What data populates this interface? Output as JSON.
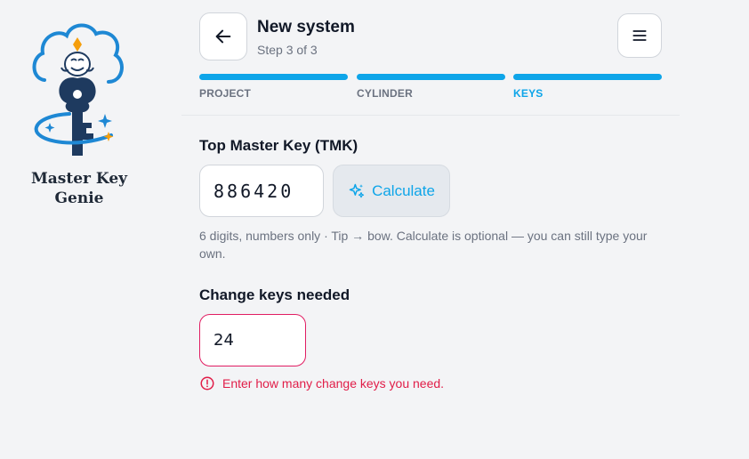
{
  "brand": {
    "name_line1": "Master Key",
    "name_line2": "Genie",
    "logo_icon": "genie-key-logo"
  },
  "header": {
    "title": "New system",
    "subtitle": "Step 3 of 3",
    "back_icon": "arrow-left-icon",
    "menu_icon": "hamburger-menu-icon"
  },
  "steps": [
    {
      "label": "PROJECT",
      "state": "complete"
    },
    {
      "label": "CYLINDER",
      "state": "complete"
    },
    {
      "label": "KEYS",
      "state": "active"
    }
  ],
  "tmk": {
    "label": "Top Master Key (TMK)",
    "value": "886420",
    "calculate_label": "Calculate",
    "calculate_icon": "sparkles-icon",
    "hint": "6 digits, numbers only · Tip → bow. Calculate is optional — you can still type your own."
  },
  "change_keys": {
    "label": "Change keys needed",
    "value": "24",
    "error": "Enter how many change keys you need.",
    "error_icon": "alert-circle-icon"
  },
  "colors": {
    "accent": "#0ea5e9",
    "error": "#e11d48",
    "background": "#f3f4f6",
    "logo_navy": "#1e3a5f"
  }
}
